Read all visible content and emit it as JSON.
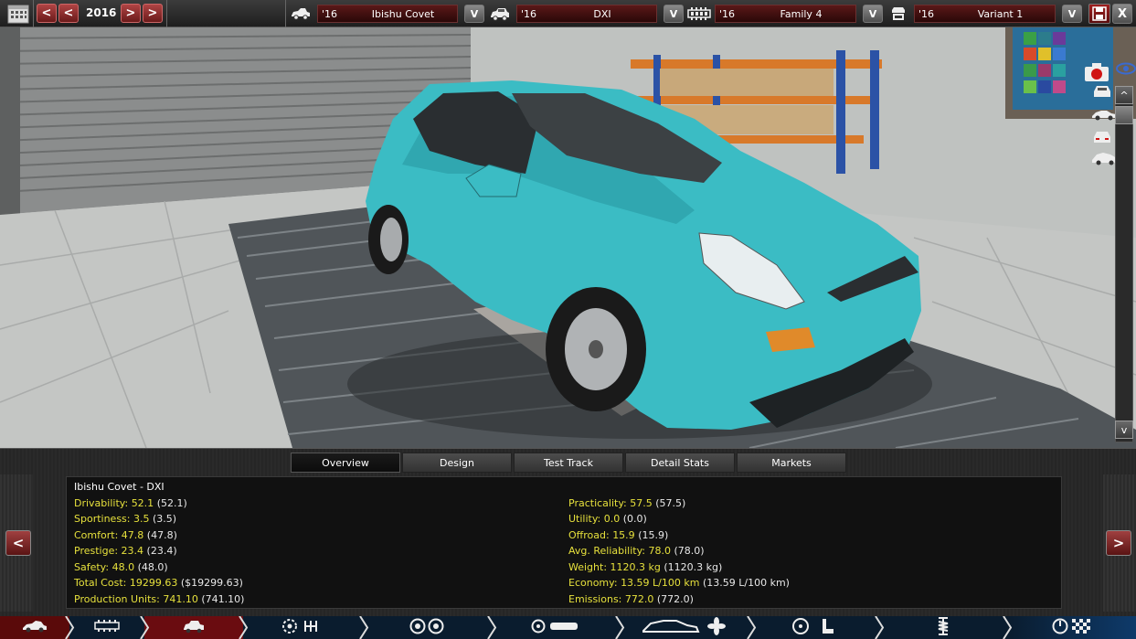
{
  "topbar": {
    "year": "2016",
    "prev_fast": "<",
    "prev": "<",
    "next": ">",
    "next_fast": ">",
    "model": {
      "year": "'16",
      "name": "Ibishu Covet",
      "dropdown": "V",
      "icon": "model-car-icon"
    },
    "trim": {
      "year": "'16",
      "name": "DXI",
      "dropdown": "V",
      "icon": "trim-car-icon"
    },
    "engine": {
      "year": "'16",
      "name": "Family 4",
      "dropdown": "V",
      "icon": "engine-block-icon"
    },
    "variant": {
      "year": "'16",
      "name": "Variant 1",
      "dropdown": "V",
      "icon": "engine-variant-icon"
    },
    "close": "X"
  },
  "viewport": {
    "car_color": "#3bbcc4",
    "scroll_up": "^",
    "scroll_down": "v"
  },
  "panel": {
    "tabs": [
      "Overview",
      "Design",
      "Test Track",
      "Detail Stats",
      "Markets"
    ],
    "active_tab": "Overview",
    "title": "Ibishu Covet - DXI",
    "left_stats": [
      {
        "label": "Drivability:",
        "value": "52.1",
        "paren": "(52.1)"
      },
      {
        "label": "Sportiness:",
        "value": "3.5",
        "paren": "(3.5)"
      },
      {
        "label": "Comfort:",
        "value": "47.8",
        "paren": "(47.8)"
      },
      {
        "label": "Prestige:",
        "value": "23.4",
        "paren": "(23.4)"
      },
      {
        "label": "Safety:",
        "value": "48.0",
        "paren": "(48.0)"
      },
      {
        "label": "Total Cost:",
        "value": "19299.63",
        "paren": "($19299.63)"
      },
      {
        "label": "Production Units:",
        "value": "741.10",
        "paren": "(741.10)"
      }
    ],
    "right_stats": [
      {
        "label": "Practicality:",
        "value": "57.5",
        "paren": "(57.5)"
      },
      {
        "label": "Utility:",
        "value": "0.0",
        "paren": "(0.0)"
      },
      {
        "label": "Offroad:",
        "value": "15.9",
        "paren": "(15.9)"
      },
      {
        "label": "Avg. Reliability:",
        "value": "78.0",
        "paren": "(78.0)"
      },
      {
        "label": "Weight:",
        "value": "1120.3 kg",
        "paren": "(1120.3 kg)"
      },
      {
        "label": "Economy:",
        "value": "13.59 L/100 km",
        "paren": "(13.59 L/100 km)"
      },
      {
        "label": "Emissions:",
        "value": "772.0",
        "paren": "(772.0)"
      }
    ],
    "prev_arrow": "<",
    "next_arrow": ">"
  },
  "bottomnav": {
    "sections": [
      {
        "icon": "car-body-icon",
        "color": "#5a0a0a"
      },
      {
        "icon": "chassis-icon",
        "color": "#0a1c2e"
      },
      {
        "icon": "trim-icon",
        "color": "#6a0c10"
      },
      {
        "icon": "engine-gearbox-icon",
        "color": "#0a1c2e"
      },
      {
        "icon": "wheels-icon",
        "color": "#0a1c2e"
      },
      {
        "icon": "brakes-suspension-icon",
        "color": "#0a1c2e"
      },
      {
        "icon": "aero-cooling-icon",
        "color": "#0a1c2e"
      },
      {
        "icon": "interior-icon",
        "color": "#0a1c2e"
      },
      {
        "icon": "suspension-tuning-icon",
        "color": "#0a1c2e"
      },
      {
        "icon": "test-finish-icon",
        "color": "#0e3a6a"
      }
    ]
  }
}
